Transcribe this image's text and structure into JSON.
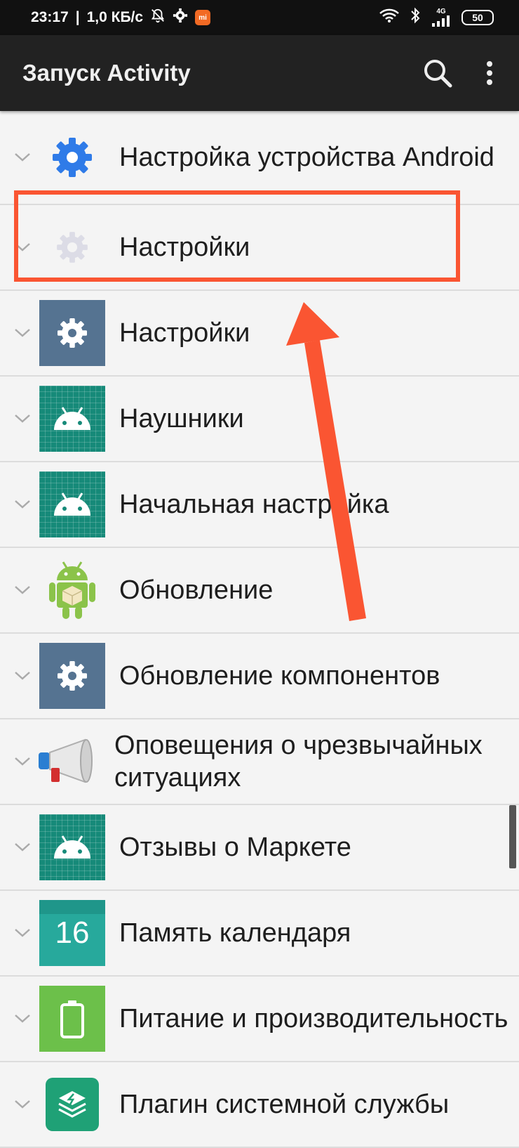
{
  "status_bar": {
    "time": "23:17",
    "speed": "1,0 КБ/с",
    "network": "4G",
    "battery": "50"
  },
  "app_bar": {
    "title": "Запуск Activity"
  },
  "items": [
    {
      "label": "Настройка устройства Android",
      "icon": "gear-blue-icon"
    },
    {
      "label": "Настройки",
      "icon": "gear-faded-icon"
    },
    {
      "label": "Настройки",
      "icon": "gear-slate-icon"
    },
    {
      "label": "Наушники",
      "icon": "android-teal-icon"
    },
    {
      "label": "Начальная настройка",
      "icon": "android-teal-icon"
    },
    {
      "label": "Обновление",
      "icon": "android-package-icon"
    },
    {
      "label": "Обновление компонентов",
      "icon": "gear-slate-icon"
    },
    {
      "label": "Оповещения о чрезвычайных ситуациях",
      "icon": "megaphone-icon"
    },
    {
      "label": "Отзывы о Маркете",
      "icon": "android-teal-icon"
    },
    {
      "label": "Память календаря",
      "icon": "calendar-icon",
      "icon_text": "16"
    },
    {
      "label": "Питание и производительность",
      "icon": "battery-icon"
    },
    {
      "label": "Плагин системной службы",
      "icon": "layers-icon"
    }
  ],
  "colors": {
    "highlight": "#fa5532",
    "app_bar": "#222222",
    "status_bar": "#111111"
  }
}
